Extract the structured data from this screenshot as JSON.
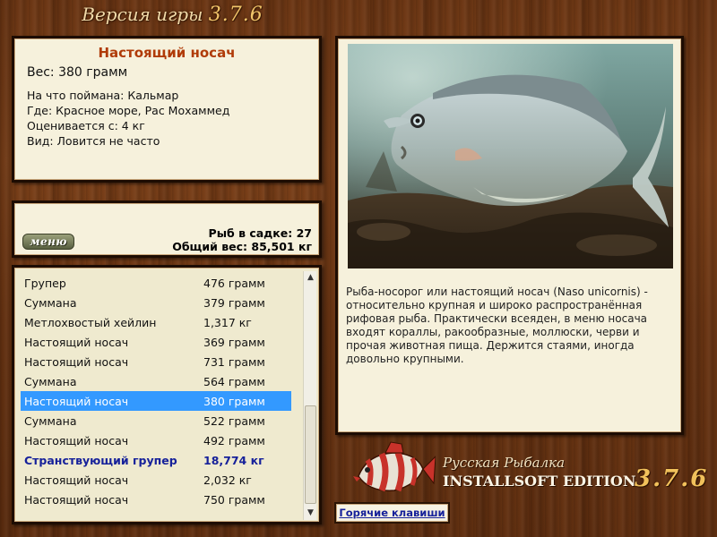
{
  "header": {
    "title_prefix": "Версия игры",
    "version": "3.7.6"
  },
  "fish_info": {
    "name": "Настоящий носач",
    "weight": "Вес: 380 грамм",
    "details": [
      "На что поймана: Кальмар",
      "Где: Красное море, Рас Мохаммед",
      "Оценивается с: 4 кг",
      "Вид: Ловится не часто"
    ]
  },
  "summary": {
    "menu_label": "меню",
    "count_line": "Рыб в садке: 27",
    "total_line": "Общий вес: 85,501 кг"
  },
  "catch_list": [
    {
      "name": "Групер",
      "weight": "476 грамм",
      "selected": false,
      "bold": false
    },
    {
      "name": "Суммана",
      "weight": "379 грамм",
      "selected": false,
      "bold": false
    },
    {
      "name": "Метлохвостый хейлин",
      "weight": "1,317 кг",
      "selected": false,
      "bold": false
    },
    {
      "name": "Настоящий носач",
      "weight": "369 грамм",
      "selected": false,
      "bold": false
    },
    {
      "name": "Настоящий носач",
      "weight": "731 грамм",
      "selected": false,
      "bold": false
    },
    {
      "name": "Суммана",
      "weight": "564 грамм",
      "selected": false,
      "bold": false
    },
    {
      "name": "Настоящий носач",
      "weight": "380 грамм",
      "selected": true,
      "bold": false
    },
    {
      "name": "Суммана",
      "weight": "522 грамм",
      "selected": false,
      "bold": false
    },
    {
      "name": "Настоящий носач",
      "weight": "492 грамм",
      "selected": false,
      "bold": false
    },
    {
      "name": "Странствующий групер",
      "weight": "18,774 кг",
      "selected": false,
      "bold": true
    },
    {
      "name": "Настоящий носач",
      "weight": "2,032 кг",
      "selected": false,
      "bold": false
    },
    {
      "name": "Настоящий носач",
      "weight": "750 грамм",
      "selected": false,
      "bold": false
    }
  ],
  "description": "Рыба-носорог или настоящий носач (Naso unicornis) - относительно крупная и широко распространённая рифовая рыба. Практически всеяден, в меню носача входят кораллы, ракообразные, моллюски, черви и прочая животная пища. Держится стаями, иногда довольно крупными.",
  "logo": {
    "line1": "Русская Рыбалка",
    "line2": "INSTALLSOFT EDITION",
    "version": "3.7.6"
  },
  "hotkeys_label": "Горячие клавиши",
  "icons": {
    "scroll_up": "triangle-up-icon",
    "scroll_down": "triangle-down-icon"
  },
  "colors": {
    "fish_title": "#b03b08",
    "selection": "#3399ff",
    "highlight_text": "#16219a",
    "version_gold": "#f1c15b"
  }
}
